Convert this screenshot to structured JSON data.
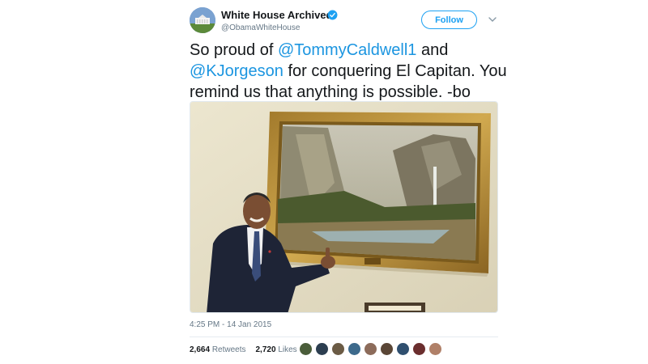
{
  "account": {
    "name": "White House Archived",
    "handle": "@ObamaWhiteHouse",
    "verified": true
  },
  "follow": {
    "label": "Follow"
  },
  "tweet": {
    "text_before": "So proud of ",
    "mention1": "@TommyCaldwell1",
    "text_middle": " and ",
    "mention2": "@KJorgeson",
    "text_after": " for conquering El Capitan. You remind us that anything is possible. -bo"
  },
  "timestamp": "4:25 PM - 14 Jan 2015",
  "stats": {
    "retweets_count": "2,664",
    "retweets_label": "Retweets",
    "likes_count": "2,720",
    "likes_label": "Likes"
  },
  "colors": {
    "accent": "#1da1f2",
    "mention": "#1b95e0",
    "muted": "#657786",
    "verified": "#1da1f2"
  },
  "liker_avatars": [
    {
      "color": "#4a5d3a"
    },
    {
      "color": "#2c3e50"
    },
    {
      "color": "#6b5b45"
    },
    {
      "color": "#3d6a8c"
    },
    {
      "color": "#8c6b5a"
    },
    {
      "color": "#5a4636"
    },
    {
      "color": "#2f4f6f"
    },
    {
      "color": "#6b2e2e"
    },
    {
      "color": "#b08068"
    }
  ]
}
